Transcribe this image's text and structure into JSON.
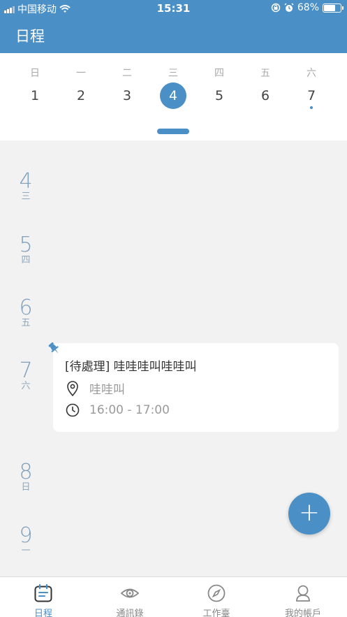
{
  "status_bar": {
    "carrier": "中国移动",
    "time": "15:31",
    "battery": "68%"
  },
  "header": {
    "title": "日程"
  },
  "week": [
    {
      "weekday": "日",
      "date": "1"
    },
    {
      "weekday": "一",
      "date": "2"
    },
    {
      "weekday": "二",
      "date": "3"
    },
    {
      "weekday": "三",
      "date": "4",
      "selected": true
    },
    {
      "weekday": "四",
      "date": "5"
    },
    {
      "weekday": "五",
      "date": "6"
    },
    {
      "weekday": "六",
      "date": "7",
      "has_event": true
    }
  ],
  "days": [
    {
      "date": "4",
      "weekday": "三"
    },
    {
      "date": "5",
      "weekday": "四"
    },
    {
      "date": "6",
      "weekday": "五"
    },
    {
      "date": "7",
      "weekday": "六"
    },
    {
      "date": "8",
      "weekday": "日"
    },
    {
      "date": "9",
      "weekday": "一"
    }
  ],
  "event": {
    "title": "[待處理] 哇哇哇叫哇哇叫",
    "location": "哇哇叫",
    "time": "16:00 - 17:00"
  },
  "fab": {
    "label": "+"
  },
  "tabs": [
    {
      "label": "日程",
      "icon": "calendar-icon",
      "active": true
    },
    {
      "label": "通訊錄",
      "icon": "eye-icon"
    },
    {
      "label": "工作臺",
      "icon": "compass-icon"
    },
    {
      "label": "我的帳戶",
      "icon": "user-icon"
    }
  ],
  "colors": {
    "accent": "#4a8fc6",
    "background": "#f2f2f2",
    "label": "#7f9fbc"
  }
}
